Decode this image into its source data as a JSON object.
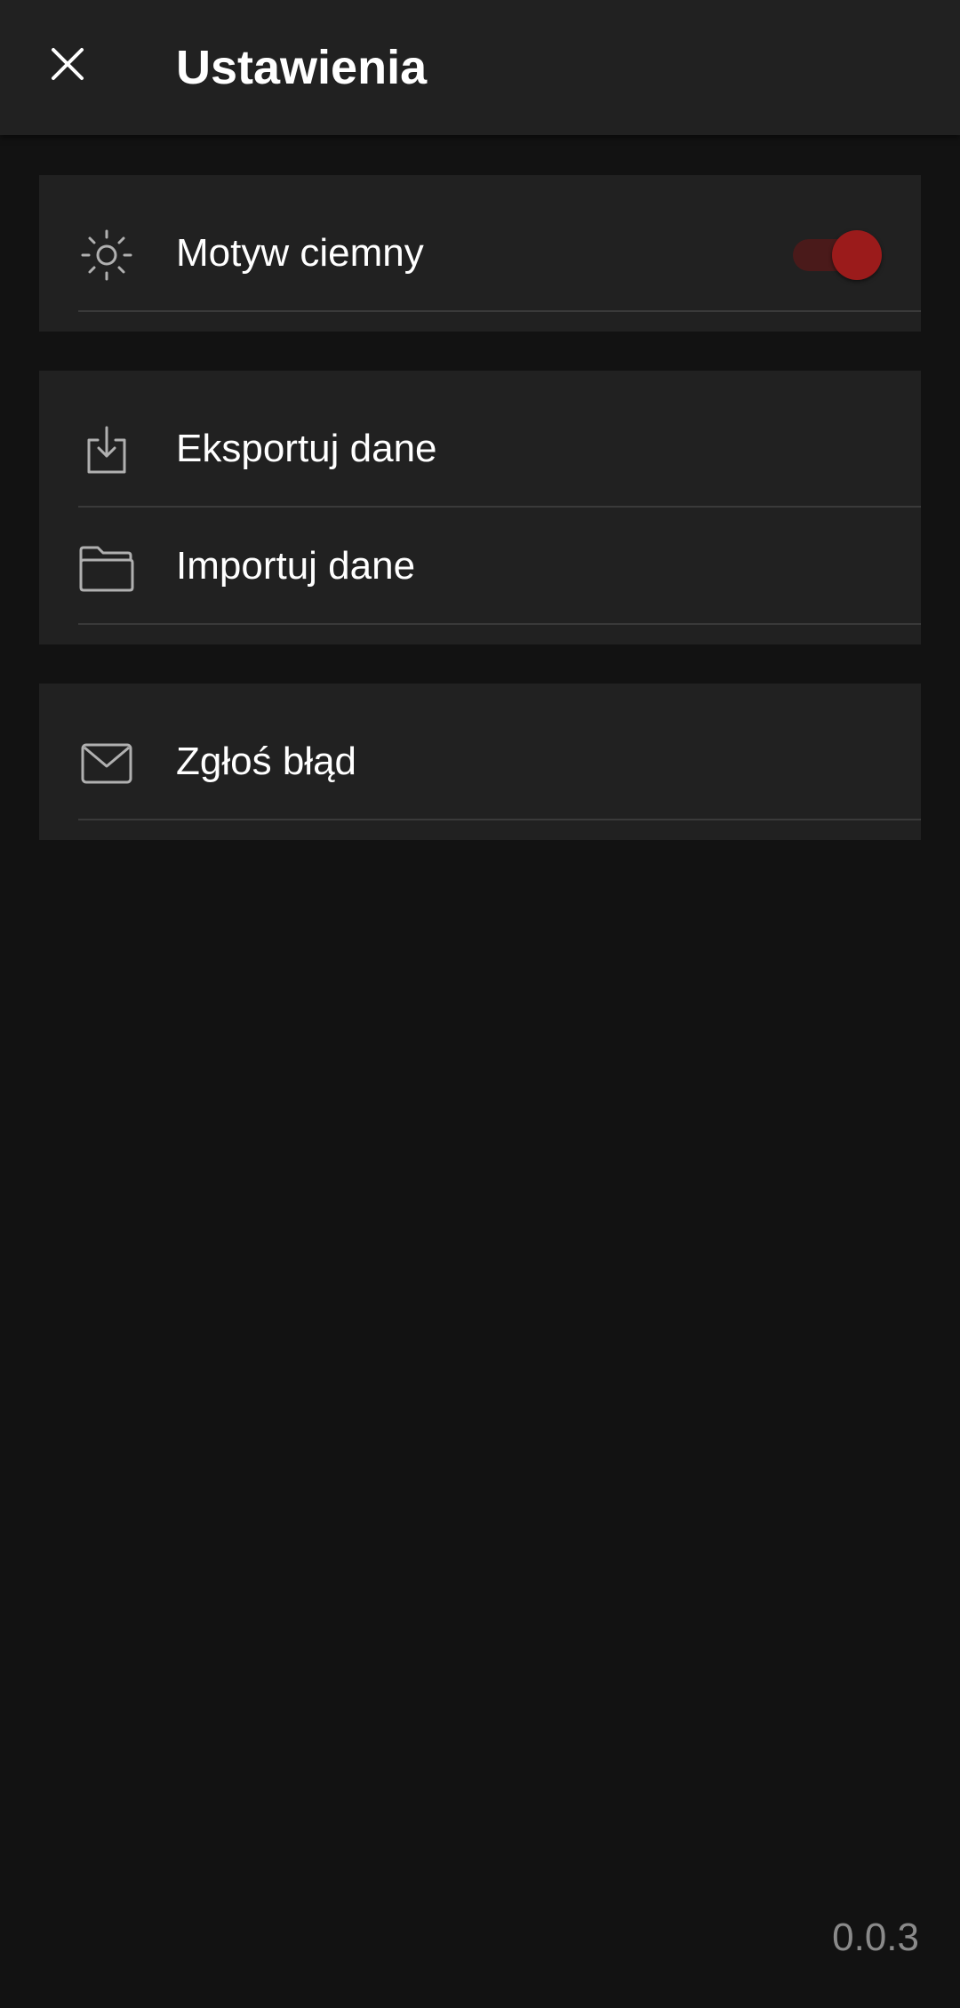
{
  "header": {
    "title": "Ustawienia"
  },
  "sections": [
    {
      "items": [
        {
          "label": "Motyw ciemny",
          "icon": "sun-icon",
          "toggle_on": true
        }
      ]
    },
    {
      "items": [
        {
          "label": "Eksportuj dane",
          "icon": "download-icon"
        },
        {
          "label": "Importuj dane",
          "icon": "folder-icon"
        }
      ]
    },
    {
      "items": [
        {
          "label": "Zgłoś błąd",
          "icon": "mail-icon"
        }
      ]
    }
  ],
  "footer": {
    "version": "0.0.3"
  },
  "colors": {
    "background": "#121212",
    "surface": "#212121",
    "accent": "#9b1b1b",
    "icon": "#b0b0b0"
  }
}
